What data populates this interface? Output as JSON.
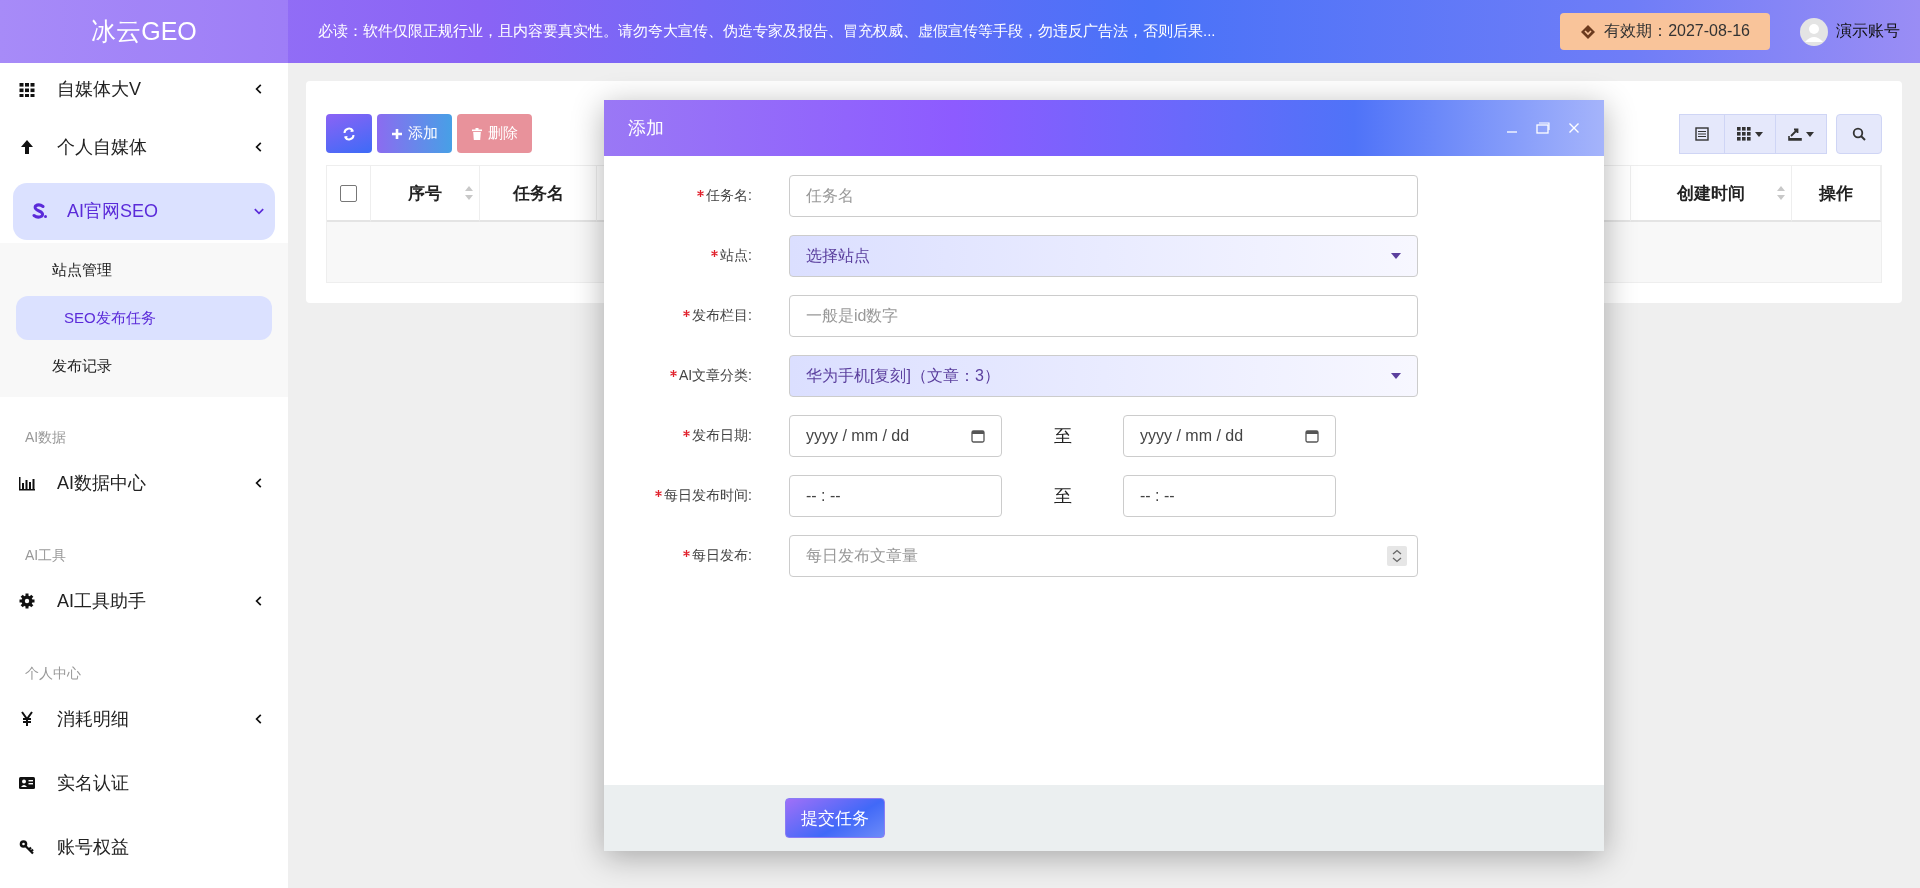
{
  "header": {
    "logo": "冰云GEO",
    "notice": "必读：软件仅限正规行业，且内容要真实性。请勿夸大宣传、伪造专家及报告、冒充权威、虚假宣传等手段，勿违反广告法，否则后果...",
    "expiry": "有效期：2027-08-16",
    "user": "演示账号"
  },
  "sidebar": {
    "items": [
      {
        "kind": "item",
        "label": "自媒体大V",
        "expanded": false,
        "selected": false
      },
      {
        "kind": "item",
        "label": "个人自媒体",
        "expanded": false,
        "selected": false
      },
      {
        "kind": "item",
        "label": "AI官网SEO",
        "expanded": true,
        "selected": true,
        "children": [
          {
            "label": "站点管理",
            "selected": false
          },
          {
            "label": "SEO发布任务",
            "selected": true
          },
          {
            "label": "发布记录",
            "selected": false
          }
        ]
      },
      {
        "kind": "section",
        "label": "AI数据"
      },
      {
        "kind": "item",
        "label": "AI数据中心",
        "expanded": false,
        "selected": false
      },
      {
        "kind": "section",
        "label": "AI工具"
      },
      {
        "kind": "item",
        "label": "AI工具助手",
        "expanded": false,
        "selected": false
      },
      {
        "kind": "section",
        "label": "个人中心"
      },
      {
        "kind": "item",
        "label": "消耗明细",
        "expanded": false,
        "selected": false
      },
      {
        "kind": "item",
        "label": "实名认证",
        "selected": false
      },
      {
        "kind": "item",
        "label": "账号权益",
        "selected": false
      }
    ]
  },
  "toolbar": {
    "add": "添加",
    "delete": "删除"
  },
  "table": {
    "select_all": {
      "checked": false
    },
    "columns": [
      {
        "label": "序号",
        "sortable": true
      },
      {
        "label": "任务名",
        "sortable": false
      },
      {
        "label": "创建时间",
        "sortable": true
      },
      {
        "label": "操作",
        "sortable": false
      }
    ]
  },
  "dialog": {
    "title": "添加",
    "fields": [
      {
        "kind": "text",
        "label": "任务名:",
        "required": true,
        "placeholder": "任务名"
      },
      {
        "kind": "select",
        "label": "站点:",
        "required": true,
        "value": "选择站点"
      },
      {
        "kind": "text",
        "label": "发布栏目:",
        "required": true,
        "placeholder": "一般是id数字"
      },
      {
        "kind": "select",
        "label": "AI文章分类:",
        "required": true,
        "value": "华为手机[复刻]（文章：3）"
      },
      {
        "kind": "date-range",
        "label": "发布日期:",
        "required": true,
        "from": "yyyy / mm / dd",
        "separator": "至",
        "to": "yyyy / mm / dd"
      },
      {
        "kind": "time-range",
        "label": "每日发布时间:",
        "required": true,
        "from": "-- : --",
        "separator": "至",
        "to": "-- : --"
      },
      {
        "kind": "number",
        "label": "每日发布:",
        "required": true,
        "placeholder": "每日发布文章量"
      }
    ],
    "submit": "提交任务"
  }
}
